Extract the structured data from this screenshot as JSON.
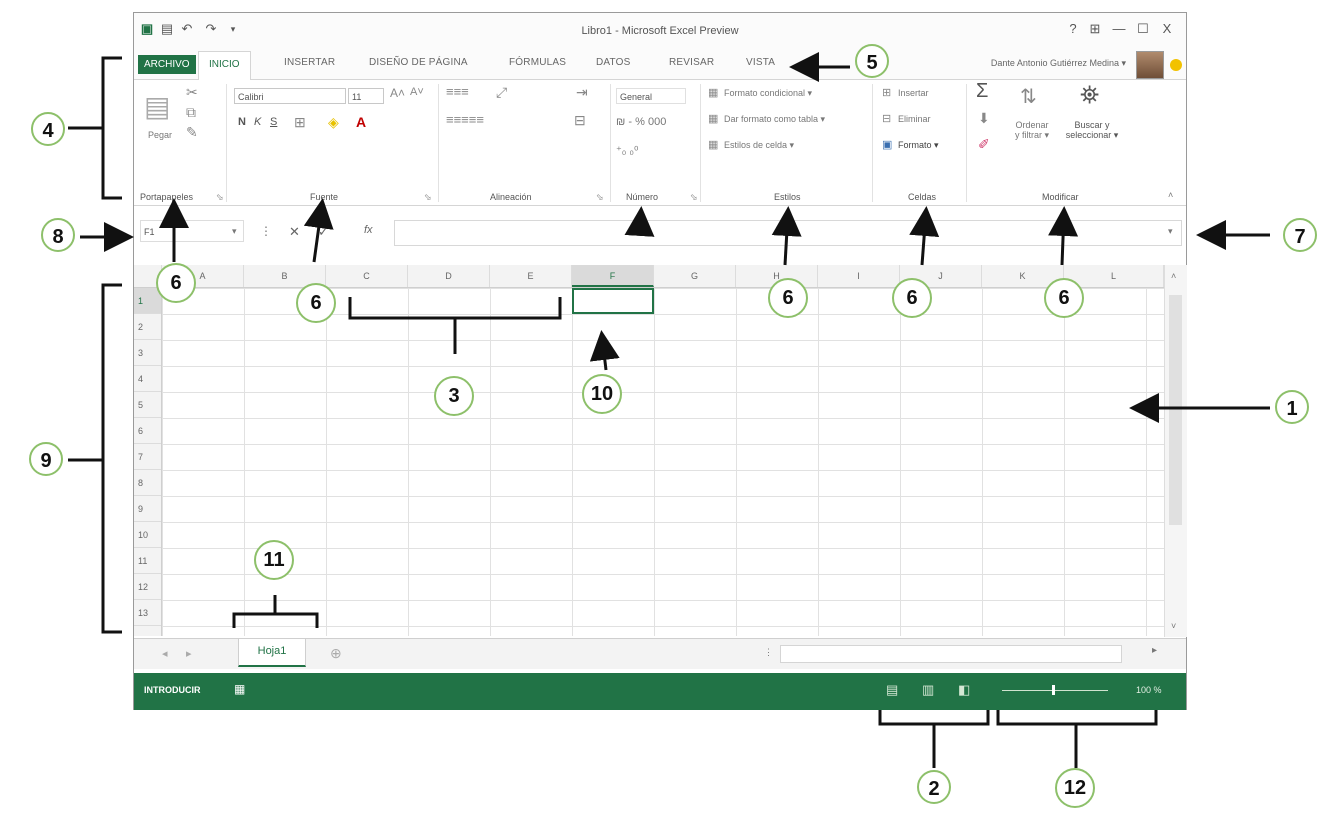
{
  "window": {
    "title": "Libro1 - Microsoft Excel Preview",
    "help": "?",
    "minimize": "—",
    "restore": "☐",
    "close": "X"
  },
  "tabs": {
    "file": "ARCHIVO",
    "items": [
      "INICIO",
      "INSERTAR",
      "DISEÑO DE PÁGINA",
      "FÓRMULAS",
      "DATOS",
      "REVISAR",
      "VISTA"
    ],
    "user": "Dante Antonio Gutiérrez Medina ▾"
  },
  "ribbon": {
    "paste": "Pegar",
    "font_name": "Calibri",
    "font_size": "11",
    "bold": "N",
    "italic": "K",
    "underline": "S",
    "number_format": "General",
    "cond_format": "Formato condicional ▾",
    "table_format": "Dar formato como tabla ▾",
    "cell_styles": "Estilos de celda ▾",
    "insert": "Insertar",
    "delete": "Eliminar",
    "format": "Formato ▾",
    "sort": "Ordenar y filtrar ▾",
    "find": "Buscar y seleccionar ▾",
    "groups": [
      "Portapapeles",
      "Fuente",
      "Alineación",
      "Número",
      "Estilos",
      "Celdas",
      "Modificar"
    ]
  },
  "formula_bar": {
    "name_box": "F1",
    "cancel": "✕",
    "enter": "✓",
    "fx": "fx"
  },
  "grid": {
    "columns": [
      "A",
      "B",
      "C",
      "D",
      "E",
      "F",
      "G",
      "H",
      "I",
      "J",
      "K",
      "L"
    ],
    "rows": [
      "1",
      "2",
      "3",
      "4",
      "5",
      "6",
      "7",
      "8",
      "9",
      "10",
      "11",
      "12",
      "13"
    ],
    "selected_cell": "F1"
  },
  "sheets": {
    "active": "Hoja1",
    "add": "⊕"
  },
  "status": {
    "mode": "INTRODUCIR",
    "zoom": "100 %"
  },
  "callouts": [
    "1",
    "2",
    "3",
    "4",
    "5",
    "6",
    "6",
    "6",
    "6",
    "6",
    "6",
    "7",
    "8",
    "9",
    "10",
    "11",
    "12"
  ],
  "colors": {
    "excel_green": "#217346",
    "callout_border": "#8dc06a"
  }
}
